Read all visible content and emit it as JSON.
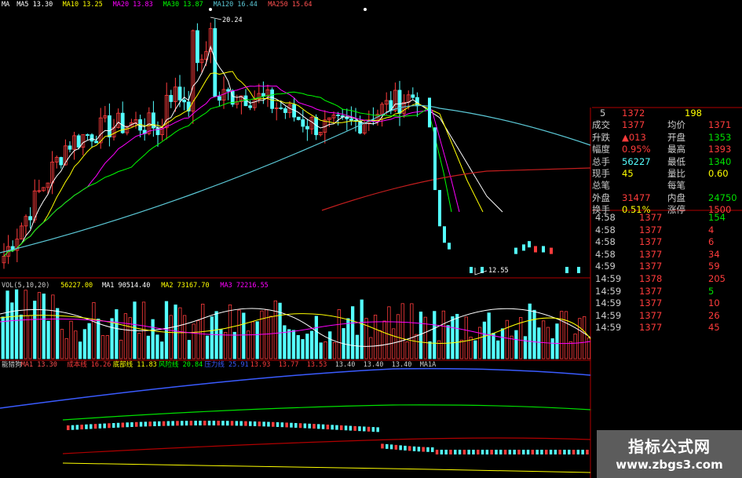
{
  "colors": {
    "up": "#ff3c3c",
    "down": "#54ffff",
    "grid": "#b00000",
    "ma5": "#ffffff",
    "ma10": "#ffff00",
    "ma20": "#ff00ff",
    "ma30": "#00ff00",
    "ma120": "#5bc8d6",
    "ma250": "#c41e1e",
    "green": "#00e000",
    "yellow": "#ffff00",
    "white": "#ffffff",
    "blue": "#3a5bff"
  },
  "price_panel": {
    "legend": [
      {
        "label": "MA",
        "color": "#ffffff"
      },
      {
        "label": "MA5 13.30",
        "color": "#ffffff"
      },
      {
        "label": "MA10 13.25",
        "color": "#ffff00"
      },
      {
        "label": "MA20 13.83",
        "color": "#ff00ff"
      },
      {
        "label": "MA30 13.87",
        "color": "#00ff00"
      },
      {
        "label": "MA120 16.44",
        "color": "#5bc8d6"
      },
      {
        "label": "MA250 15.64",
        "color": "#ff5050"
      }
    ],
    "peak_label": "20.24",
    "low_label": "12.55"
  },
  "volume_panel": {
    "legend": [
      {
        "label": "VOL(5,10,20)",
        "color": "#cccccc"
      },
      {
        "label": "56227.00",
        "color": "#ffff00"
      },
      {
        "label": "MA1 90514.40",
        "color": "#ffffff"
      },
      {
        "label": "MA2 73167.70",
        "color": "#ffff00"
      },
      {
        "label": "MA3 72216.55",
        "color": "#ff00ff"
      }
    ]
  },
  "indicator_panel": {
    "legend": [
      {
        "label": "能猎狗",
        "color": "#cccccc"
      },
      {
        "label": "MA1 13.30",
        "color": "#ff5050"
      },
      {
        "label": "成本线 16.26",
        "color": "#ff3c3c"
      },
      {
        "label": "底部线 11.83",
        "color": "#ffff00"
      },
      {
        "label": "风险线 20.84",
        "color": "#00ff00"
      },
      {
        "label": "压力线 25.91",
        "color": "#3a5bff"
      },
      {
        "label": "13.93",
        "color": "#ff3c3c"
      },
      {
        "label": "13.77",
        "color": "#ff3c3c"
      },
      {
        "label": "13.53",
        "color": "#ff3c3c"
      },
      {
        "label": "13.40",
        "color": "#cccccc"
      },
      {
        "label": "13.40",
        "color": "#cccccc"
      },
      {
        "label": "13.40",
        "color": "#cccccc"
      },
      {
        "label": "MA1A",
        "color": "#cccccc"
      }
    ]
  },
  "quote": {
    "top_ask": {
      "level": "5",
      "price": "1372",
      "volume": "198"
    },
    "rows": [
      {
        "l1": "成交",
        "v1": "1377",
        "c1": "#ff3c3c",
        "l2": "均价",
        "v2": "1371",
        "c2": "#ff3c3c"
      },
      {
        "l1": "升跌",
        "v1": "▲013",
        "c1": "#ff3c3c",
        "l2": "开盘",
        "v2": "1353",
        "c2": "#00e000"
      },
      {
        "l1": "幅度",
        "v1": "0.95%",
        "c1": "#ff3c3c",
        "l2": "最高",
        "v2": "1393",
        "c2": "#ff3c3c"
      },
      {
        "l1": "总手",
        "v1": "56227",
        "c1": "#54ffff",
        "l2": "最低",
        "v2": "1340",
        "c2": "#00e000"
      },
      {
        "l1": "现手",
        "v1": "45",
        "c1": "#ffff00",
        "l2": "量比",
        "v2": "0.60",
        "c2": "#ffff00"
      },
      {
        "l1": "总笔",
        "v1": "",
        "c1": "#cccccc",
        "l2": "每笔",
        "v2": "",
        "c2": "#cccccc"
      },
      {
        "l1": "外盘",
        "v1": "31477",
        "c1": "#ff3c3c",
        "l2": "内盘",
        "v2": "24750",
        "c2": "#00e000"
      },
      {
        "l1": "换手",
        "v1": "0.51%",
        "c1": "#ffff00",
        "l2": "涨停",
        "v2": "1500",
        "c2": "#ff3c3c"
      }
    ]
  },
  "ticks": [
    {
      "time": "4:58",
      "price": "1377",
      "volume": "154",
      "vcolor": "#00e000"
    },
    {
      "time": "4:58",
      "price": "1377",
      "volume": "4",
      "vcolor": "#ff3c3c"
    },
    {
      "time": "4:58",
      "price": "1377",
      "volume": "6",
      "vcolor": "#ff3c3c"
    },
    {
      "time": "4:58",
      "price": "1377",
      "volume": "34",
      "vcolor": "#ff3c3c"
    },
    {
      "time": "4:59",
      "price": "1377",
      "volume": "59",
      "vcolor": "#ff3c3c"
    },
    {
      "time": "14:59",
      "price": "1378",
      "volume": "205",
      "vcolor": "#ff3c3c"
    },
    {
      "time": "14:59",
      "price": "1377",
      "volume": "5",
      "vcolor": "#00e000"
    },
    {
      "time": "14:59",
      "price": "1377",
      "volume": "10",
      "vcolor": "#ff3c3c"
    },
    {
      "time": "14:59",
      "price": "1377",
      "volume": "26",
      "vcolor": "#ff3c3c"
    },
    {
      "time": "14:59",
      "price": "1377",
      "volume": "45",
      "vcolor": "#ff3c3c"
    }
  ],
  "watermark": {
    "title": "指标公式网",
    "url": "www.zbgs3.com"
  },
  "chart_data": {
    "type": "candlestick",
    "title": "",
    "price_range": [
      12.55,
      20.24
    ],
    "peak_value": 20.24,
    "low_value": 12.55,
    "moving_averages": {
      "MA5": 13.3,
      "MA10": 13.25,
      "MA20": 13.83,
      "MA30": 13.87,
      "MA120": 16.44,
      "MA250": 15.64
    },
    "volume_indicators": {
      "VOL": 56227.0,
      "MA1": 90514.4,
      "MA2": 73167.7,
      "MA3": 72216.55
    },
    "custom_indicator": {
      "MA1": 13.3,
      "成本线": 16.26,
      "底部线": 11.83,
      "风险线": 20.84,
      "压力线": 25.91
    }
  }
}
